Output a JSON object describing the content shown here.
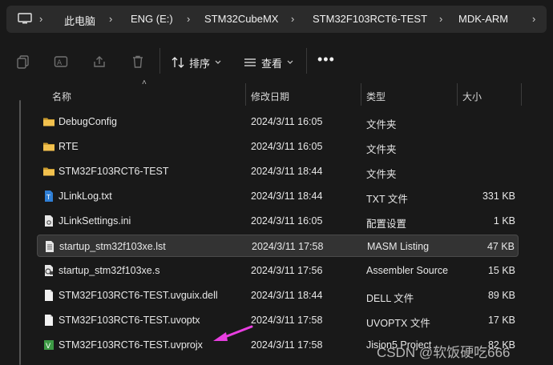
{
  "breadcrumb": [
    "此电脑",
    "ENG (E:)",
    "STM32CubeMX",
    "STM32F103RCT6-TEST",
    "MDK-ARM"
  ],
  "toolbar": {
    "sort_label": "排序",
    "view_label": "查看",
    "more_label": "•••"
  },
  "columns": {
    "name": "名称",
    "date": "修改日期",
    "type": "类型",
    "size": "大小"
  },
  "files": [
    {
      "name": "DebugConfig",
      "date": "2024/3/11 16:05",
      "type": "文件夹",
      "size": "",
      "icon": "folder-icon"
    },
    {
      "name": "RTE",
      "date": "2024/3/11 16:05",
      "type": "文件夹",
      "size": "",
      "icon": "folder-icon"
    },
    {
      "name": "STM32F103RCT6-TEST",
      "date": "2024/3/11 18:44",
      "type": "文件夹",
      "size": "",
      "icon": "folder-icon"
    },
    {
      "name": "JLinkLog.txt",
      "date": "2024/3/11 18:44",
      "type": "TXT 文件",
      "size": "331 KB",
      "icon": "text-file-icon"
    },
    {
      "name": "JLinkSettings.ini",
      "date": "2024/3/11 16:05",
      "type": "配置设置",
      "size": "1 KB",
      "icon": "settings-file-icon"
    },
    {
      "name": "startup_stm32f103xe.lst",
      "date": "2024/3/11 17:58",
      "type": "MASM Listing",
      "size": "47 KB",
      "icon": "listing-file-icon"
    },
    {
      "name": "startup_stm32f103xe.s",
      "date": "2024/3/11 17:56",
      "type": "Assembler Source",
      "size": "15 KB",
      "icon": "asm-file-icon"
    },
    {
      "name": "STM32F103RCT6-TEST.uvguix.dell",
      "date": "2024/3/11 18:44",
      "type": "DELL 文件",
      "size": "89 KB",
      "icon": "generic-file-icon"
    },
    {
      "name": "STM32F103RCT6-TEST.uvoptx",
      "date": "2024/3/11 17:58",
      "type": "UVOPTX 文件",
      "size": "17 KB",
      "icon": "generic-file-icon"
    },
    {
      "name": "STM32F103RCT6-TEST.uvprojx",
      "date": "2024/3/11 17:58",
      "type": "Jision5 Project",
      "size": "82 KB",
      "icon": "keil-project-icon"
    }
  ],
  "selected_index": 5,
  "watermark": "CSDN @软饭硬吃666",
  "colors": {
    "folder": "#f2c14e",
    "arrow": "#e83ee0",
    "selected_row": "#333333"
  }
}
